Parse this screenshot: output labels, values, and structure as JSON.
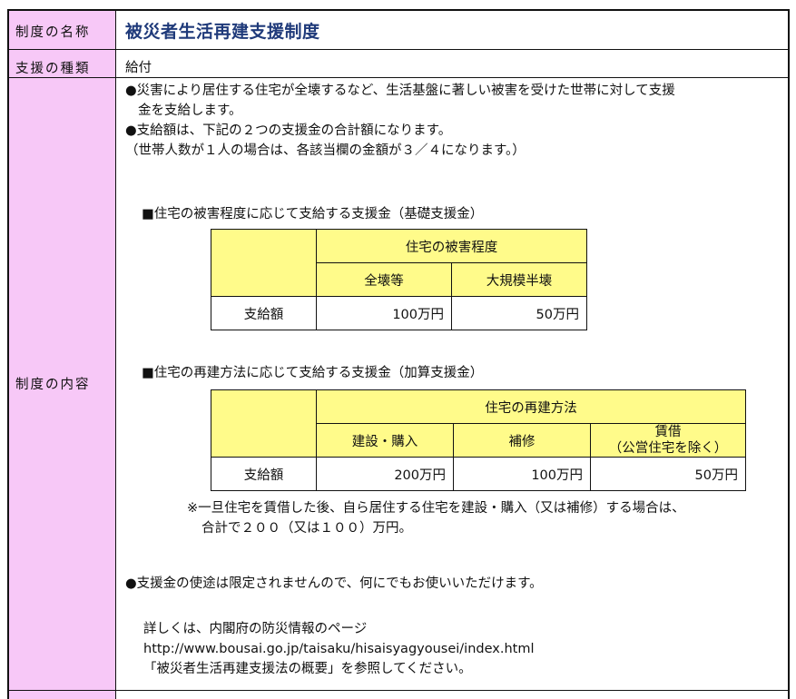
{
  "rows": {
    "name_label": "制度の名称",
    "name_value": "被災者生活再建支援制度",
    "type_label": "支援の種類",
    "type_value": "給付",
    "content_label": "制度の内容"
  },
  "content": {
    "p1_line1": "●災害により居住する住宅が全壊するなど、生活基盤に著しい被害を受けた世帯に対して支援",
    "p1_line2": "金を支給します。",
    "p2_line1": "●支給額は、下記の２つの支援金の合計額になります。",
    "p2_line2": "（世帯人数が１人の場合は、各該当欄の金額が３／４になります。）",
    "section1_title": "■住宅の被害程度に応じて支給する支援金（基礎支援金）",
    "section2_title": "■住宅の再建方法に応じて支給する支援金（加算支援金）",
    "note_line1": "※一旦住宅を賃借した後、自ら居住する住宅を建設・購入（又は補修）する場合は、",
    "note_line2": "合計で２００（又は１００）万円。",
    "p3": "●支援金の使途は限定されませんので、何にでもお使いいただけます。",
    "detail_line1": "詳しくは、内閣府の防災情報のページ",
    "detail_line2": "http://www.bousai.go.jp/taisaku/hisaisyagyousei/index.html",
    "detail_line3": "「被災者生活再建支援法の概要」を参照してください。"
  },
  "table1": {
    "group_header": "住宅の被害程度",
    "col1": "全壊等",
    "col2": "大規模半壊",
    "row_label": "支給額",
    "val1": "100万円",
    "val2": "50万円"
  },
  "table2": {
    "group_header": "住宅の再建方法",
    "col1": "建設・購入",
    "col2": "補修",
    "col3_line1": "賃借",
    "col3_line2": "（公営住宅を除く）",
    "row_label": "支給額",
    "val1": "200万円",
    "val2": "100万円",
    "val3": "50万円"
  },
  "colors": {
    "label_bg": "#f7c8f7",
    "table_header_bg": "#fffb8a",
    "title_color": "#1f3a7a",
    "bullet_color": "#3b6fd1"
  }
}
